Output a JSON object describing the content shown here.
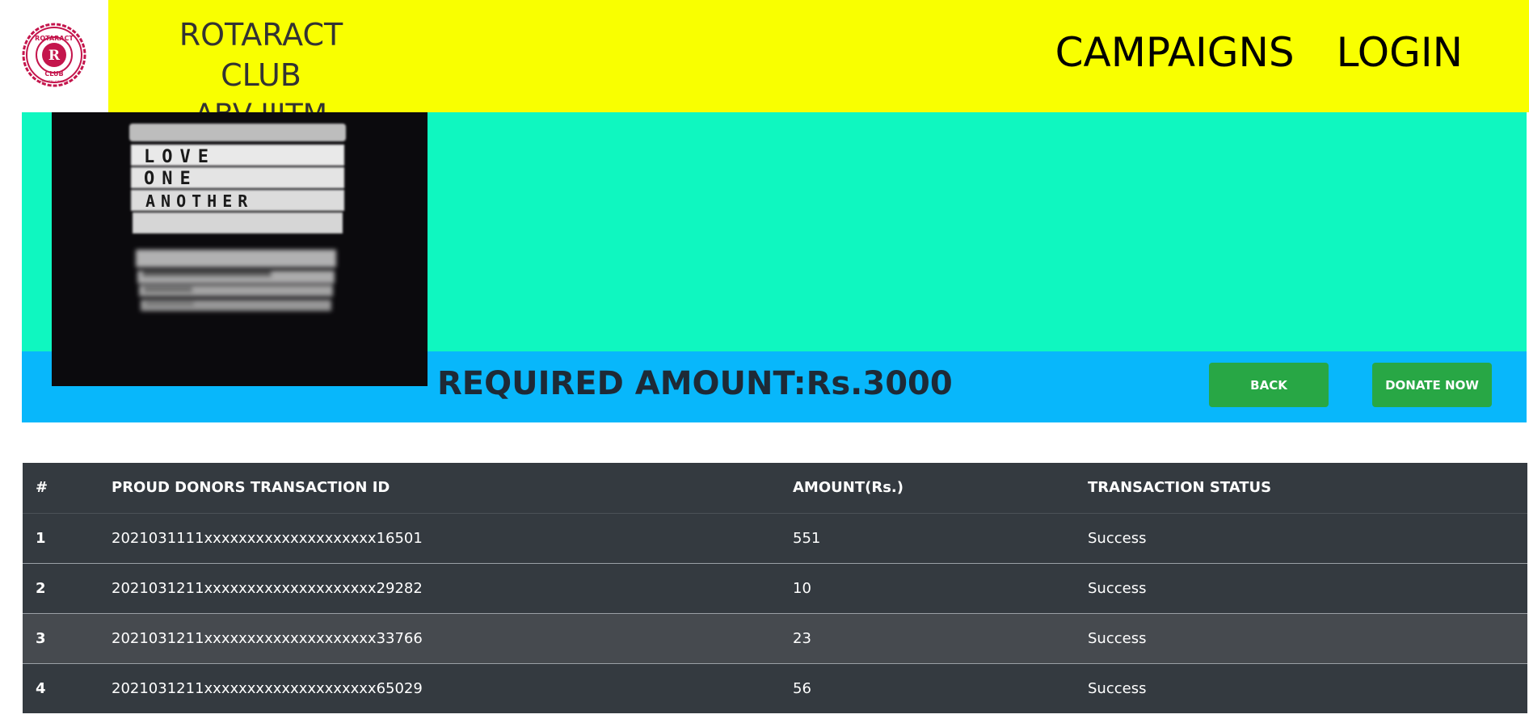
{
  "header": {
    "logo_icon": "rotaract-club-emblem-icon",
    "logo_text": {
      "top": "ROTARACT",
      "letter": "R",
      "bottom": "CLUB",
      "tiny": "ABV-IIITM, GWALIOR"
    },
    "club_name_line1": "ROTARACT CLUB",
    "club_name_line2": "ABV-IIITM",
    "nav": {
      "campaigns": "CAMPAIGNS",
      "login": "LOGIN"
    }
  },
  "campaign": {
    "image_icon": "love-one-another-lightbox-image",
    "image_text": [
      "LOVE",
      "ONE",
      "ANOTHER"
    ],
    "required_amount": "REQUIRED AMOUNT:Rs.3000",
    "back_label": "BACK",
    "donate_label": "DONATE NOW"
  },
  "donors_table": {
    "headers": [
      "#",
      "PROUD DONORS TRANSACTION ID",
      "AMOUNT(Rs.)",
      "TRANSACTION STATUS"
    ],
    "rows": [
      {
        "index": "1",
        "transaction_id": "2021031111xxxxxxxxxxxxxxxxxxxx16501",
        "amount": "551",
        "status": "Success"
      },
      {
        "index": "2",
        "transaction_id": "2021031211xxxxxxxxxxxxxxxxxxxx29282",
        "amount": "10",
        "status": "Success"
      },
      {
        "index": "3",
        "transaction_id": "2021031211xxxxxxxxxxxxxxxxxxxx33766",
        "amount": "23",
        "status": "Success"
      },
      {
        "index": "4",
        "transaction_id": "2021031211xxxxxxxxxxxxxxxxxxxx65029",
        "amount": "56",
        "status": "Success"
      }
    ]
  },
  "colors": {
    "header_bg": "#f9ff00",
    "banner_top": "#0ff7c0",
    "banner_bottom": "#08b7fb",
    "button_green": "#28a745",
    "table_dark": "#343a40",
    "logo_crimson": "#c4154c"
  }
}
